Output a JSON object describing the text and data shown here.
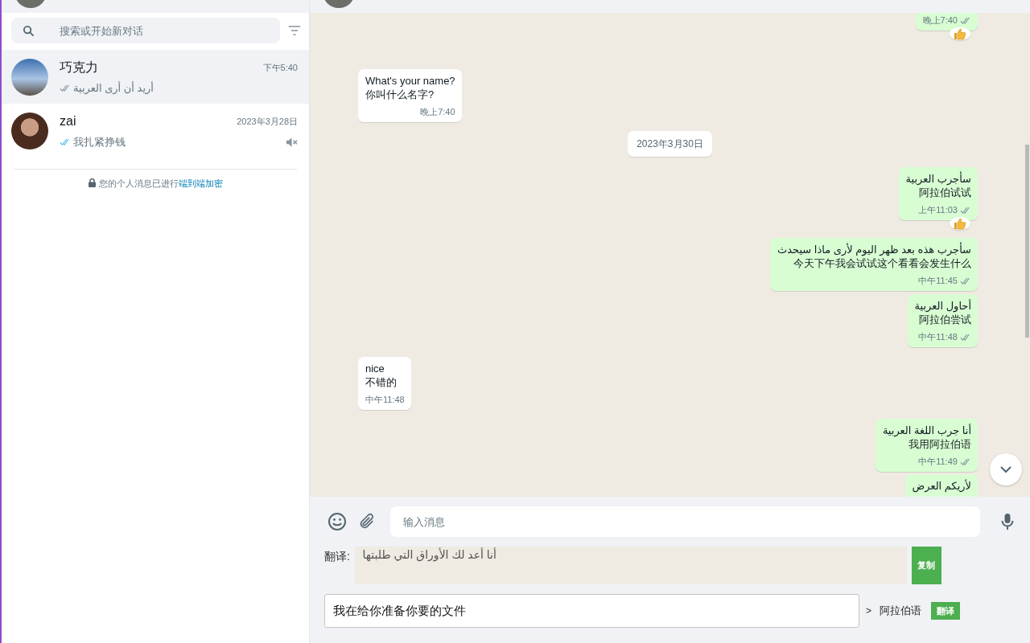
{
  "sidebar": {
    "search": {
      "placeholder": "搜索或开始新对话"
    },
    "chats": [
      {
        "name": "巧克力",
        "time": "下午5:40",
        "preview": "أريد أن أرى العربية",
        "read": false,
        "muted": false,
        "selected": true
      },
      {
        "name": "zai",
        "time": "2023年3月28日",
        "preview": "我扎紧挣钱",
        "read": true,
        "muted": true,
        "selected": false
      }
    ],
    "encryption_note": {
      "text": "您的个人消息已进行",
      "link": "端到端加密"
    }
  },
  "messages": [
    {
      "kind": "outgoing",
      "time": "晚上7:40",
      "read": false,
      "reacted": true
    },
    {
      "kind": "incoming",
      "lines": [
        "What's your name?",
        "你叫什么名字?"
      ],
      "time": "晚上7:40",
      "reacted": false
    },
    {
      "kind": "date",
      "lines": [
        "2023年3月30日"
      ]
    },
    {
      "kind": "outgoing",
      "lines": [
        "سأجرب العربية",
        "阿拉伯试试"
      ],
      "time": "上午11:03",
      "read": false,
      "reacted": true
    },
    {
      "kind": "outgoing",
      "lines": [
        "سأجرب هذه بعد ظهر اليوم لأرى ماذا سيحدث",
        "今天下午我会试试这个看看会发生什么"
      ],
      "time": "中午11:45",
      "read": false,
      "reacted": false
    },
    {
      "kind": "outgoing",
      "lines": [
        "أحاول العربية",
        "阿拉伯尝试"
      ],
      "time": "中午11:48",
      "read": false,
      "reacted": false
    },
    {
      "kind": "incoming",
      "lines": [
        "nice",
        "不错的"
      ],
      "time": "中午11:48",
      "reacted": false
    },
    {
      "kind": "outgoing",
      "lines": [
        "أنا جرب اللغة العربية",
        "我用阿拉伯语"
      ],
      "time": "中午11:49",
      "read": false,
      "reacted": false
    },
    {
      "kind": "outgoing",
      "lines": [
        "لأريكم العرض"
      ],
      "reacted": false
    }
  ],
  "composer": {
    "placeholder": "输入消息"
  },
  "translator": {
    "label": "翻译:",
    "result": "أنا أعد لك الأوراق التي طلبتها",
    "copy_button": "复制",
    "input": "我在给你准备你要的文件",
    "arrow": ">",
    "language": "阿拉伯语",
    "translate_button": "翻译"
  }
}
